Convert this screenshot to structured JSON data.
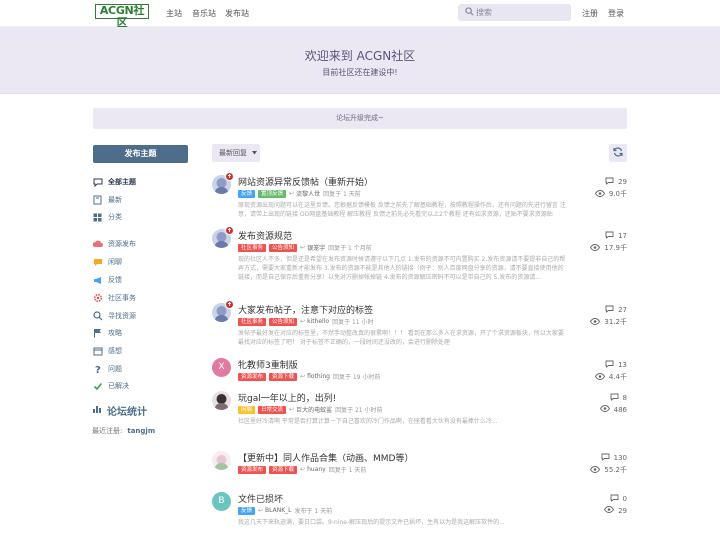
{
  "header": {
    "logo": "ACGN社区",
    "nav": [
      "主站",
      "音乐站",
      "发布站"
    ],
    "search_placeholder": "搜索",
    "register": "注册",
    "login": "登录"
  },
  "hero": {
    "title": "欢迎来到 ACGN社区",
    "subtitle": "目前社区还在建设中!"
  },
  "notice": "论坛升级完成~",
  "sidebar": {
    "post_button": "发布主题",
    "items": [
      {
        "label": "全部主题",
        "icon": "chat-icon"
      },
      {
        "label": "最新",
        "icon": "book-icon"
      },
      {
        "label": "分类",
        "icon": "grid-icon"
      },
      {
        "label": "资源发布",
        "icon": "cloud-icon"
      },
      {
        "label": "闲聊",
        "icon": "chat-icon"
      },
      {
        "label": "反馈",
        "icon": "megaphone-icon"
      },
      {
        "label": "社区事务",
        "icon": "gear-icon"
      },
      {
        "label": "寻找资源",
        "icon": "search-icon"
      },
      {
        "label": "攻略",
        "icon": "flag-icon"
      },
      {
        "label": "感想",
        "icon": "calendar-icon"
      },
      {
        "label": "问题",
        "icon": "question-icon"
      },
      {
        "label": "已解决",
        "icon": "check-icon"
      }
    ],
    "stats_title": "论坛统计",
    "stats_label": "最近注册:",
    "stats_user": "tangjm"
  },
  "toolbar": {
    "sort": "最新回复"
  },
  "topics": [
    {
      "title": "网站资源异常反馈帖（重新开始）",
      "pinned": true,
      "avatar_type": "image",
      "tags": [
        {
          "text": "反馈",
          "color": "#42a5f5"
        },
        {
          "text": "置顶反馈",
          "color": "#66bb6a"
        }
      ],
      "author": "流黎人世",
      "meta": "回复于 1 天前",
      "excerpt": "原现资源出现问题可以在这里反馈。您根据反馈模板 反馈之前先了解基础教程，按照教程操作后，还有问题的先进行留言 注意，请带上出现的链接 OD网盘基础教程 解压教程 反馈之前先必先看完以上2个教程 还有如求资源，还贴不要求资源贴",
      "replies": "29",
      "views": "9.0千"
    },
    {
      "title": "发布资源规范",
      "pinned": true,
      "avatar_type": "image",
      "tags": [
        {
          "text": "社区事务",
          "color": "#ef5350"
        },
        {
          "text": "公告须知",
          "color": "#ef5350"
        }
      ],
      "author": "银笼宇",
      "meta": "回复于 1 个月前",
      "excerpt": "现的社区人不多，但是还是希望在发布资源时候请遵守以下几点 1.发布的资源不可内置购买 2.发布资源请不要提非自己的帮弄方式，需要大家重新才能发布 3.发布的资源不能是其他人的链接（例子：别人百度网盘分享的资源，请不要直接使用他的链接，而是自己保存后重新分享）以免对方删掉帐掉链 4.发布的资源解压密码不可以是带自己的 5.发布的资源请...",
      "replies": "17",
      "views": "17.9千"
    },
    {
      "title": "大家发布帖子，注意下对应的标签",
      "pinned": true,
      "avatar_type": "image",
      "tags": [
        {
          "text": "社区事务",
          "color": "#ef5350"
        },
        {
          "text": "公告须知",
          "color": "#ef5350"
        }
      ],
      "author": "kithello",
      "meta": "回复于 11 小时",
      "excerpt": "发帖子最好发在对应的标签里，不然手动整改真的很累啊！！！ 看到在那么多人在求资源，开了个求资源板块，所以大家要最找对应的标签了吧！ 对于标签不正确的，一段时间还没改的，会进行删除处理",
      "replies": "27",
      "views": "31.2千"
    },
    {
      "title": "牝教师3重制版",
      "pinned": false,
      "avatar_type": "letter",
      "avatar_letter": "X",
      "avatar_color": "#e07aa0",
      "tags": [
        {
          "text": "资源发布",
          "color": "#ef5350"
        },
        {
          "text": "资源下载",
          "color": "#ef5350"
        }
      ],
      "author": "flothing",
      "meta": "回复于 19 小时前",
      "excerpt": "",
      "replies": "13",
      "views": "4.4千"
    },
    {
      "title": "玩gal一年以上的，出列!",
      "pinned": false,
      "avatar_type": "image",
      "tags": [
        {
          "text": "闲聊",
          "color": "#fbc02d"
        },
        {
          "text": "日常交流",
          "color": "#ef5350"
        }
      ],
      "author": "巨大的电蚊鲨",
      "meta": "回复于 21 小时前",
      "excerpt": "社区里好冷清啊 平常是否打算计算一下自己喜欢的冷门作品啊，在座看看大伙有没有最棒什么冷...",
      "replies": "8",
      "views": "486"
    },
    {
      "title": "【更新中】同人作品合集（动画、MMD等）",
      "pinned": false,
      "avatar_type": "image",
      "tags": [
        {
          "text": "资源发布",
          "color": "#ef5350"
        },
        {
          "text": "资源下载",
          "color": "#ef5350"
        }
      ],
      "author": "huany",
      "meta": "回复于 1 天前",
      "excerpt": "",
      "replies": "130",
      "views": "55.2千"
    },
    {
      "title": "文件已损坏",
      "pinned": false,
      "avatar_type": "letter",
      "avatar_letter": "B",
      "avatar_color": "#6cc4c0",
      "tags": [
        {
          "text": "反馈",
          "color": "#42a5f5"
        }
      ],
      "author": "BLANK_L",
      "meta": "发布于 1 天前",
      "excerpt": "我这几天下来轨迹满，要日口袋。9-nine-解压现后的提示文件已损坏，生有以为是我这解压软件的...",
      "replies": "0",
      "views": "29"
    }
  ]
}
